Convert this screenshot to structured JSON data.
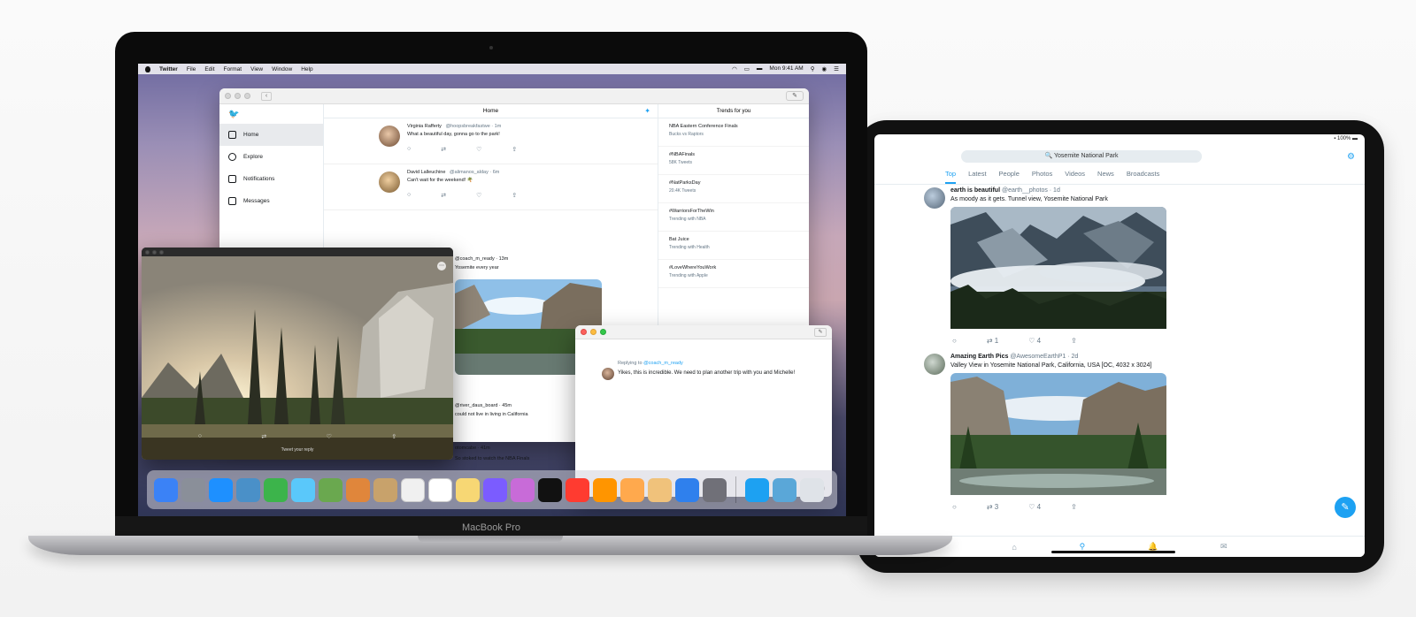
{
  "mac": {
    "brand": "MacBook Pro",
    "menubar": {
      "app": "Twitter",
      "menus": [
        "File",
        "Edit",
        "Format",
        "View",
        "Window",
        "Help"
      ],
      "clock": "Mon 9:41 AM"
    },
    "twitter_window": {
      "sidebar": [
        {
          "label": "Home",
          "active": true
        },
        {
          "label": "Explore",
          "active": false
        },
        {
          "label": "Notifications",
          "active": false
        },
        {
          "label": "Messages",
          "active": false
        }
      ],
      "header": "Home",
      "tweets": [
        {
          "name": "Virginia Rafferty",
          "handle": "@hoopsbreakfastwe · 1m",
          "text": "What a beautiful day, gonna go to the park!"
        },
        {
          "name": "David Lalleuchine",
          "handle": "@alimanos_alday · 6m",
          "text": "Can't wait for the weekend! 🌴"
        }
      ],
      "partial_tweet": {
        "handle": "@coach_m_ready · 13m",
        "text": "Yosemite every year"
      },
      "lower_tweets": [
        {
          "handle": "@river_daus_board · 45m",
          "text": "could not live in living in California"
        },
        {
          "handle": "otomcabe · 41m",
          "text": "So stoked to watch the NBA Finals"
        }
      ],
      "trends_header": "Trends for you",
      "trends": [
        {
          "title": "NBA Eastern Conference Finals",
          "sub": "Bucks vs Raptors"
        },
        {
          "title": "#NBAFinals",
          "sub": "58K Tweets"
        },
        {
          "title": "#NatParksDay",
          "sub": "20.4K Tweets"
        },
        {
          "title": "#WarriorsForTheWin",
          "sub": "Trending with NBA"
        },
        {
          "title": "Bat Juice",
          "sub": "Trending with Health"
        },
        {
          "title": "#LoveWhereYouWork",
          "sub": "Trending with Apple"
        }
      ]
    },
    "photo_window": {
      "caption": "Tweet your reply"
    },
    "reply_window": {
      "replying_prefix": "Replying to",
      "replying_to": "@coach_m_ready",
      "text": "Yikes, this is incredible. We need to plan another trip with you and Michelle!"
    },
    "dock": {
      "colors": [
        "#3b82f6",
        "#8a8f99",
        "#1e90ff",
        "#4a90c8",
        "#3cb44b",
        "#5ac8fa",
        "#6aa84f",
        "#e0863b",
        "#c8a26b",
        "#f0f0f0",
        "#ffffff",
        "#f7d774",
        "#7b5cff",
        "#c86bd8",
        "#111111",
        "#ff3b30",
        "#ff9500",
        "#ffa94d",
        "#f0c27b",
        "#2f80ed",
        "#707078",
        "#1da1f2",
        "#5aa7d8",
        "#dfe3e8"
      ]
    }
  },
  "ipad": {
    "status": "▪ 100% ▬",
    "search": "Yosemite National Park",
    "tabs": [
      {
        "label": "Top",
        "active": true
      },
      {
        "label": "Latest",
        "active": false
      },
      {
        "label": "People",
        "active": false
      },
      {
        "label": "Photos",
        "active": false
      },
      {
        "label": "Videos",
        "active": false
      },
      {
        "label": "News",
        "active": false
      },
      {
        "label": "Broadcasts",
        "active": false
      }
    ],
    "tweets": [
      {
        "name": "earth is beautiful",
        "handle": "@earth__photos · 1d",
        "text": "As moody as it gets. Tunnel view, Yosemite National Park",
        "counts": [
          "",
          "1",
          "4",
          ""
        ]
      },
      {
        "name": "Amazing Earth Pics",
        "handle": "@AwesomeEarthP1 · 2d",
        "text": "Valley View in Yosemite National Park, California, USA [OC, 4032 x 3024]",
        "counts": [
          "",
          "3",
          "4",
          ""
        ]
      }
    ]
  }
}
